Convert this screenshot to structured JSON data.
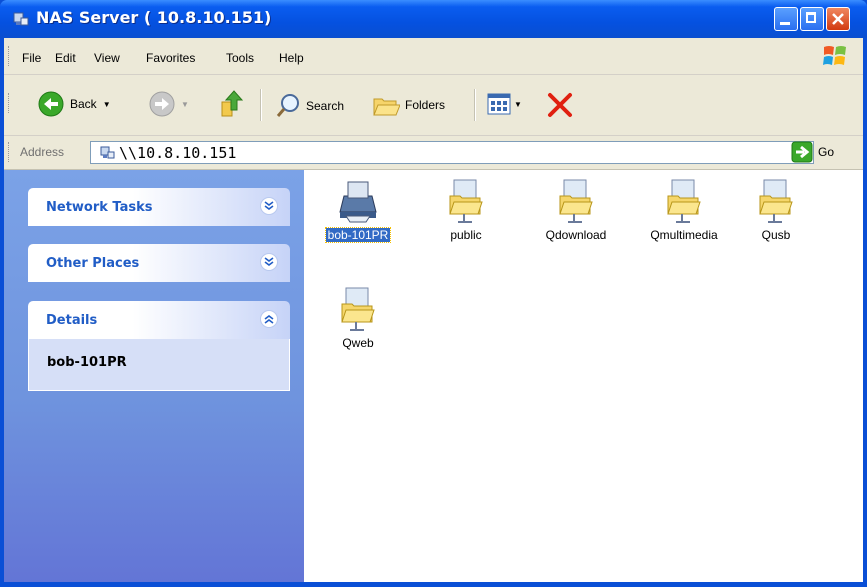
{
  "window": {
    "title": "NAS Server ( 10.8.10.151)"
  },
  "menu": [
    {
      "label": "File"
    },
    {
      "label": "Edit"
    },
    {
      "label": "View"
    },
    {
      "label": "Favorites"
    },
    {
      "label": "Tools"
    },
    {
      "label": "Help"
    }
  ],
  "toolbar": {
    "back_label": "Back",
    "search_label": "Search",
    "folders_label": "Folders"
  },
  "address": {
    "label": "Address",
    "value": "\\\\10.8.10.151",
    "go_label": "Go"
  },
  "tasks": {
    "network_tasks": "Network Tasks",
    "other_places": "Other Places",
    "details": "Details",
    "details_name": "bob-101PR"
  },
  "items": [
    {
      "label": "bob-101PR",
      "type": "printer",
      "selected": true
    },
    {
      "label": "public",
      "type": "shared-folder"
    },
    {
      "label": "Qdownload",
      "type": "shared-folder"
    },
    {
      "label": "Qmultimedia",
      "type": "shared-folder"
    },
    {
      "label": "Qusb",
      "type": "shared-folder"
    },
    {
      "label": "Qweb",
      "type": "shared-folder"
    }
  ],
  "colors": {
    "titlebar": "#0551e0",
    "selection": "#316ac5",
    "task_pane": "#7ba2e7",
    "panel_title": "#215dc6"
  }
}
